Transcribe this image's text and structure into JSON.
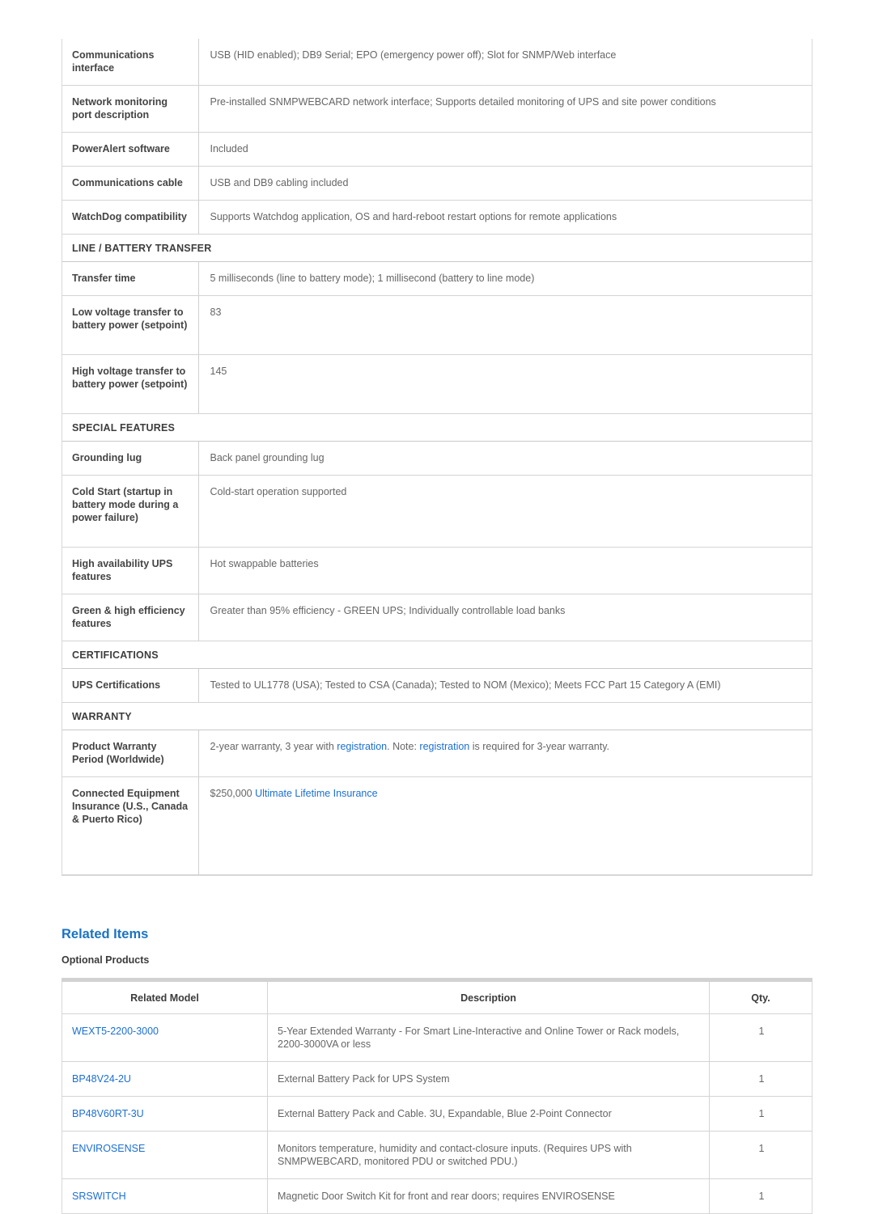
{
  "spec_table": {
    "rows": [
      {
        "kind": "row",
        "label": "Communications interface",
        "value": "USB (HID enabled); DB9 Serial; EPO (emergency power off); Slot for SNMP/Web interface",
        "height": "tall-1"
      },
      {
        "kind": "row",
        "label": "Network monitoring port description",
        "value": "Pre-installed SNMPWEBCARD network interface; Supports detailed monitoring of UPS and site power conditions",
        "height": "tall-1"
      },
      {
        "kind": "row",
        "label": "PowerAlert software",
        "value": "Included",
        "height": "tall-0"
      },
      {
        "kind": "row",
        "label": "Communications cable",
        "value": "USB and DB9 cabling included",
        "height": "tall-1"
      },
      {
        "kind": "row",
        "label": "WatchDog compatibility",
        "value": "Supports Watchdog application, OS and hard-reboot restart options for remote applications",
        "height": "tall-1"
      },
      {
        "kind": "section",
        "label": "LINE / BATTERY TRANSFER"
      },
      {
        "kind": "row",
        "label": "Transfer time",
        "value": "5 milliseconds (line to battery mode); 1 millisecond (battery to line mode)",
        "height": "tall-0"
      },
      {
        "kind": "row",
        "label": "Low voltage transfer to battery power (setpoint)",
        "value": "83",
        "height": "tall-2"
      },
      {
        "kind": "row",
        "label": "High voltage transfer to battery power (setpoint)",
        "value": "145",
        "height": "tall-2"
      },
      {
        "kind": "section",
        "label": "SPECIAL FEATURES"
      },
      {
        "kind": "row",
        "label": "Grounding lug",
        "value": "Back panel grounding lug",
        "height": "tall-0"
      },
      {
        "kind": "row",
        "label": "Cold Start (startup in battery mode during a power failure)",
        "value": "Cold-start operation supported",
        "height": "tall-2"
      },
      {
        "kind": "row",
        "label": "High availability UPS features",
        "value": "Hot swappable batteries",
        "height": "tall-1"
      },
      {
        "kind": "row",
        "label": "Green & high efficiency features",
        "value": "Greater than 95% efficiency - GREEN UPS; Individually controllable load banks",
        "height": "tall-1"
      },
      {
        "kind": "section",
        "label": "CERTIFICATIONS"
      },
      {
        "kind": "row",
        "label": "UPS Certifications",
        "value": "Tested to UL1778 (USA); Tested to CSA (Canada); Tested to NOM (Mexico); Meets FCC Part 15 Category A (EMI)",
        "height": "tall-0"
      },
      {
        "kind": "section",
        "label": "WARRANTY"
      },
      {
        "kind": "row-rich",
        "label": "Product Warranty Period (Worldwide)",
        "height": "tall-1",
        "parts": [
          {
            "t": "text",
            "s": "2-year warranty, 3 year with "
          },
          {
            "t": "link",
            "s": "registration"
          },
          {
            "t": "text",
            "s": ". Note: "
          },
          {
            "t": "link",
            "s": "registration"
          },
          {
            "t": "text",
            "s": " is required for 3-year warranty."
          }
        ]
      },
      {
        "kind": "row-rich",
        "label": "Connected Equipment Insurance (U.S., Canada & Puerto Rico)",
        "height": "tall-4",
        "parts": [
          {
            "t": "text",
            "s": "$250,000 "
          },
          {
            "t": "link",
            "s": "Ultimate Lifetime Insurance"
          }
        ]
      }
    ]
  },
  "related": {
    "title": "Related Items",
    "subtitle": "Optional Products",
    "columns": [
      "Related Model",
      "Description",
      "Qty."
    ],
    "rows": [
      {
        "model": "WEXT5-2200-3000",
        "description": "5-Year Extended Warranty - For Smart Line-Interactive and Online Tower or Rack models, 2200-3000VA or less",
        "qty": "1"
      },
      {
        "model": "BP48V24-2U",
        "description": "External Battery Pack for UPS System",
        "qty": "1"
      },
      {
        "model": "BP48V60RT-3U",
        "description": "External Battery Pack and Cable. 3U, Expandable, Blue 2-Point Connector",
        "qty": "1"
      },
      {
        "model": "ENVIROSENSE",
        "description": "Monitors temperature, humidity and contact-closure inputs. (Requires UPS with SNMPWEBCARD, monitored PDU or switched PDU.)",
        "qty": "1"
      },
      {
        "model": "SRSWITCH",
        "description": "Magnetic Door Switch Kit for front and rear doors; requires ENVIROSENSE",
        "qty": "1"
      }
    ]
  },
  "colors": {
    "link": "#1a6fd4",
    "heading": "#1a73c4",
    "label_text": "#444444",
    "value_text": "#666666",
    "border": "#d4d4d4"
  }
}
